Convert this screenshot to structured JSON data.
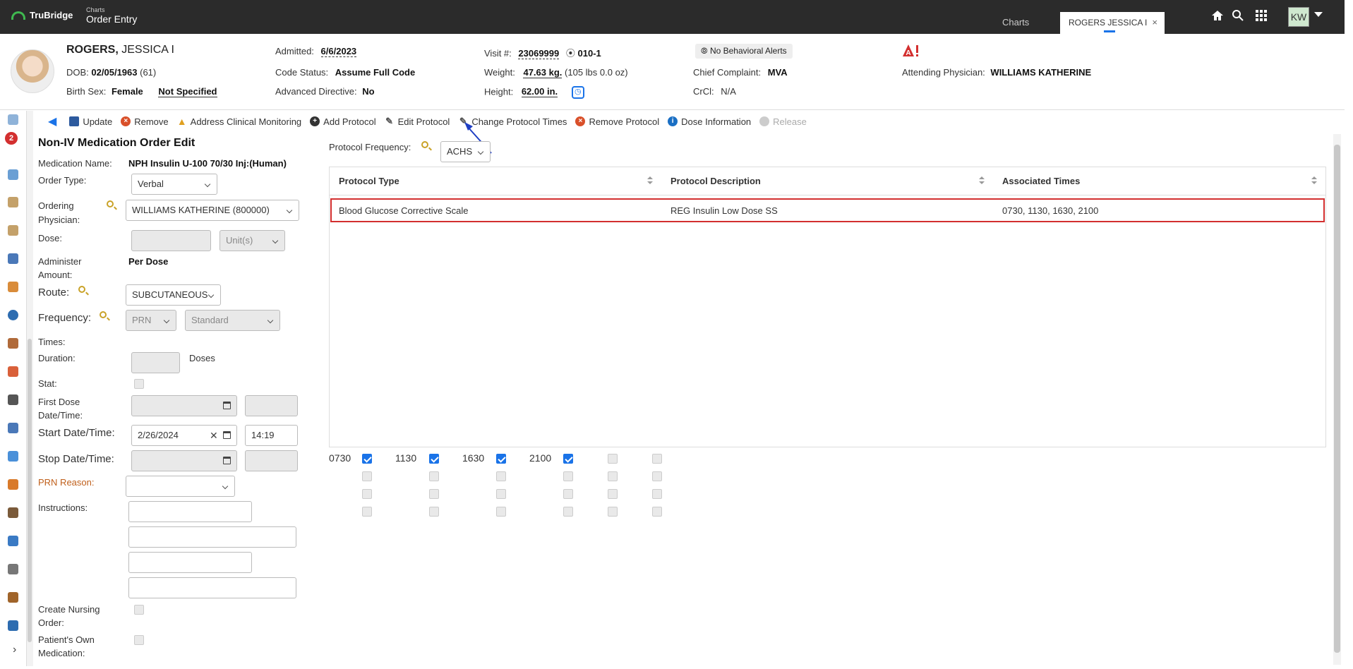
{
  "app": {
    "brand": "TruBridge",
    "module_small": "Charts",
    "module_title": "Order Entry"
  },
  "tabs": {
    "charts": "Charts",
    "patient": "ROGERS JESSICA I",
    "close": "×"
  },
  "user": {
    "initials": "KW"
  },
  "patient": {
    "last_name": "ROGERS,",
    "first_name": "JESSICA I",
    "dob_label": "DOB:",
    "dob": "02/05/1963",
    "age": "(61)",
    "sex_label": "Birth Sex:",
    "sex": "Female",
    "gender": "Not Specified",
    "admitted_label": "Admitted:",
    "admitted": "6/6/2023",
    "code_status_label": "Code Status:",
    "code_status": "Assume Full Code",
    "directive_label": "Advanced Directive:",
    "directive": "No",
    "visit_label": "Visit #:",
    "visit": "23069999",
    "room": "010-1",
    "weight_label": "Weight:",
    "weight": "47.63 kg.",
    "weight_lbs": "(105 lbs 0.0 oz)",
    "height_label": "Height:",
    "height": "62.00 in.",
    "behavioral_alert": "No Behavioral Alerts",
    "complaint_label": "Chief Complaint:",
    "complaint": "MVA",
    "crcl_label": "CrCl:",
    "crcl": "N/A",
    "physician_label": "Attending Physician:",
    "physician": "WILLIAMS KATHERINE"
  },
  "sidebar": {
    "badge_count": "2",
    "expand": "›"
  },
  "toolbar": {
    "update": "Update",
    "remove": "Remove",
    "address": "Address Clinical Monitoring",
    "add_protocol": "Add Protocol",
    "edit_protocol": "Edit Protocol",
    "change_times": "Change Protocol Times",
    "remove_protocol": "Remove Protocol",
    "dose_info": "Dose Information",
    "release": "Release"
  },
  "form": {
    "title": "Non-IV Medication Order Edit",
    "med_label": "Medication Name:",
    "med": "NPH Insulin U-100 70/30 Inj:(Human)",
    "order_type_label": "Order Type:",
    "order_type": "Verbal",
    "ordering_label_1": "Ordering",
    "ordering_label_2": "Physician:",
    "ordering": "WILLIAMS KATHERINE (800000)",
    "dose_label": "Dose:",
    "dose_unit": "Unit(s)",
    "admin_label_1": "Administer",
    "admin_label_2": "Amount:",
    "admin": "Per Dose",
    "route_label": "Route:",
    "route": "SUBCUTANEOUS",
    "freq_label": "Frequency:",
    "freq": "PRN",
    "freq_type": "Standard",
    "times_label": "Times:",
    "duration_label": "Duration:",
    "duration_unit": "Doses",
    "stat_label": "Stat:",
    "first_dose_label_1": "First Dose",
    "first_dose_label_2": "Date/Time:",
    "start_label": "Start Date/Time:",
    "start_date": "2/26/2024",
    "start_time": "14:19",
    "stop_label": "Stop Date/Time:",
    "prn_label": "PRN Reason:",
    "instructions_label": "Instructions:",
    "nursing_label_1": "Create Nursing",
    "nursing_label_2": "Order:",
    "own_med_label_1": "Patient's Own",
    "own_med_label_2": "Medication:"
  },
  "protocol": {
    "freq_label": "Protocol Frequency:",
    "freq": "ACHS",
    "headers": [
      "Protocol Type",
      "Protocol Description",
      "Associated Times"
    ],
    "rows": [
      {
        "type": "Blood Glucose Corrective Scale",
        "description": "REG Insulin Low Dose SS",
        "times": "0730, 1130, 1630, 2100"
      }
    ],
    "time_slots": [
      "0730",
      "1130",
      "1630",
      "2100"
    ]
  },
  "colors": {
    "accent": "#1a73e8",
    "alert": "#d32f2f",
    "topbar": "#2b2b2b"
  }
}
